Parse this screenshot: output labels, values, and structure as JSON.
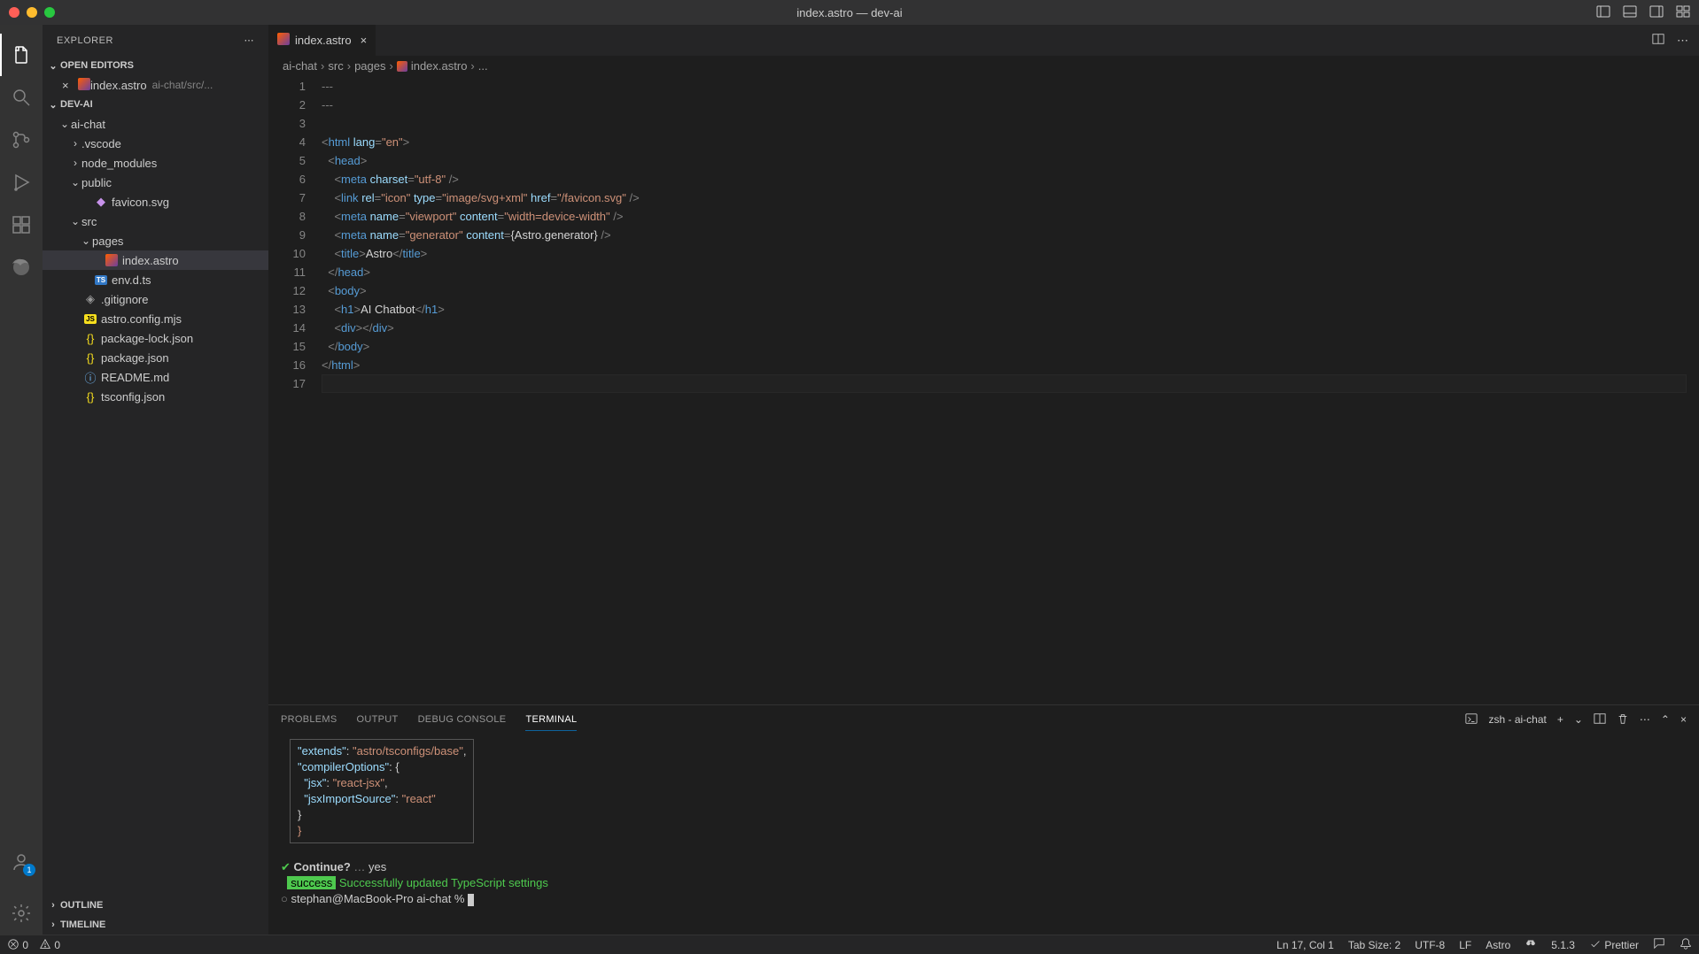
{
  "titlebar": {
    "title": "index.astro — dev-ai"
  },
  "sidebar": {
    "title": "EXPLORER",
    "sections": {
      "open_editors": {
        "label": "OPEN EDITORS",
        "items": [
          {
            "name": "index.astro",
            "path": "ai-chat/src/..."
          }
        ]
      },
      "workspace": {
        "label": "DEV-AI",
        "tree": [
          {
            "name": "ai-chat",
            "depth": 1,
            "expanded": true,
            "folder": true
          },
          {
            "name": ".vscode",
            "depth": 2,
            "expanded": false,
            "folder": true
          },
          {
            "name": "node_modules",
            "depth": 2,
            "expanded": false,
            "folder": true
          },
          {
            "name": "public",
            "depth": 2,
            "expanded": true,
            "folder": true
          },
          {
            "name": "favicon.svg",
            "depth": 3,
            "folder": false,
            "icon": "svg"
          },
          {
            "name": "src",
            "depth": 2,
            "expanded": true,
            "folder": true
          },
          {
            "name": "pages",
            "depth": 3,
            "expanded": true,
            "folder": true
          },
          {
            "name": "index.astro",
            "depth": 4,
            "folder": false,
            "icon": "astro",
            "selected": true
          },
          {
            "name": "env.d.ts",
            "depth": 3,
            "folder": false,
            "icon": "ts"
          },
          {
            "name": ".gitignore",
            "depth": 2,
            "folder": false,
            "icon": "git"
          },
          {
            "name": "astro.config.mjs",
            "depth": 2,
            "folder": false,
            "icon": "js"
          },
          {
            "name": "package-lock.json",
            "depth": 2,
            "folder": false,
            "icon": "json"
          },
          {
            "name": "package.json",
            "depth": 2,
            "folder": false,
            "icon": "json"
          },
          {
            "name": "README.md",
            "depth": 2,
            "folder": false,
            "icon": "info"
          },
          {
            "name": "tsconfig.json",
            "depth": 2,
            "folder": false,
            "icon": "json"
          }
        ]
      },
      "outline": {
        "label": "OUTLINE"
      },
      "timeline": {
        "label": "TIMELINE"
      }
    }
  },
  "tabs": [
    {
      "label": "index.astro"
    }
  ],
  "breadcrumb": [
    "ai-chat",
    "src",
    "pages",
    "index.astro",
    "..."
  ],
  "code": {
    "lines": [
      {
        "n": 1,
        "html": "<span class='tok-gray'>---</span>"
      },
      {
        "n": 2,
        "html": "<span class='tok-gray'>---</span>"
      },
      {
        "n": 3,
        "html": ""
      },
      {
        "n": 4,
        "html": "<span class='tok-gray'>&lt;</span><span class='tok-tag'>html</span> <span class='tok-attr'>lang</span><span class='tok-gray'>=</span><span class='tok-str'>\"en\"</span><span class='tok-gray'>&gt;</span>"
      },
      {
        "n": 5,
        "html": "  <span class='tok-gray'>&lt;</span><span class='tok-tag'>head</span><span class='tok-gray'>&gt;</span>"
      },
      {
        "n": 6,
        "html": "    <span class='tok-gray'>&lt;</span><span class='tok-tag'>meta</span> <span class='tok-attr'>charset</span><span class='tok-gray'>=</span><span class='tok-str'>\"utf-8\"</span> <span class='tok-gray'>/&gt;</span>"
      },
      {
        "n": 7,
        "html": "    <span class='tok-gray'>&lt;</span><span class='tok-tag'>link</span> <span class='tok-attr'>rel</span><span class='tok-gray'>=</span><span class='tok-str'>\"icon\"</span> <span class='tok-attr'>type</span><span class='tok-gray'>=</span><span class='tok-str'>\"image/svg+xml\"</span> <span class='tok-attr'>href</span><span class='tok-gray'>=</span><span class='tok-str'>\"/favicon.svg\"</span> <span class='tok-gray'>/&gt;</span>"
      },
      {
        "n": 8,
        "html": "    <span class='tok-gray'>&lt;</span><span class='tok-tag'>meta</span> <span class='tok-attr'>name</span><span class='tok-gray'>=</span><span class='tok-str'>\"viewport\"</span> <span class='tok-attr'>content</span><span class='tok-gray'>=</span><span class='tok-str'>\"width=device-width\"</span> <span class='tok-gray'>/&gt;</span>"
      },
      {
        "n": 9,
        "html": "    <span class='tok-gray'>&lt;</span><span class='tok-tag'>meta</span> <span class='tok-attr'>name</span><span class='tok-gray'>=</span><span class='tok-str'>\"generator\"</span> <span class='tok-attr'>content</span><span class='tok-gray'>=</span><span class='tok-text'>{Astro.generator}</span> <span class='tok-gray'>/&gt;</span>"
      },
      {
        "n": 10,
        "html": "    <span class='tok-gray'>&lt;</span><span class='tok-tag'>title</span><span class='tok-gray'>&gt;</span><span class='tok-text'>Astro</span><span class='tok-gray'>&lt;/</span><span class='tok-tag'>title</span><span class='tok-gray'>&gt;</span>"
      },
      {
        "n": 11,
        "html": "  <span class='tok-gray'>&lt;/</span><span class='tok-tag'>head</span><span class='tok-gray'>&gt;</span>"
      },
      {
        "n": 12,
        "html": "  <span class='tok-gray'>&lt;</span><span class='tok-tag'>body</span><span class='tok-gray'>&gt;</span>"
      },
      {
        "n": 13,
        "html": "    <span class='tok-gray'>&lt;</span><span class='tok-tag'>h1</span><span class='tok-gray'>&gt;</span><span class='tok-text'>AI Chatbot</span><span class='tok-gray'>&lt;/</span><span class='tok-tag'>h1</span><span class='tok-gray'>&gt;</span>"
      },
      {
        "n": 14,
        "html": "    <span class='tok-gray'>&lt;</span><span class='tok-tag'>div</span><span class='tok-gray'>&gt;&lt;/</span><span class='tok-tag'>div</span><span class='tok-gray'>&gt;</span>"
      },
      {
        "n": 15,
        "html": "  <span class='tok-gray'>&lt;/</span><span class='tok-tag'>body</span><span class='tok-gray'>&gt;</span>"
      },
      {
        "n": 16,
        "html": "<span class='tok-gray'>&lt;/</span><span class='tok-tag'>html</span><span class='tok-gray'>&gt;</span>"
      },
      {
        "n": 17,
        "html": ""
      }
    ]
  },
  "panel": {
    "tabs": [
      "PROBLEMS",
      "OUTPUT",
      "DEBUG CONSOLE",
      "TERMINAL"
    ],
    "active_tab": "TERMINAL",
    "terminal_label": "zsh - ai-chat",
    "terminal": {
      "box_lines": [
        "  \"extends\": \"astro/tsconfigs/base\",",
        "  \"compilerOptions\": {",
        "    \"jsx\": \"react-jsx\",",
        "    \"jsxImportSource\": \"react\"",
        "  }",
        "}"
      ],
      "continue_prompt": "Continue?",
      "continue_dots": "…",
      "continue_answer": "yes",
      "success_pill": "success",
      "success_msg": "Successfully updated TypeScript settings",
      "prompt": "stephan@MacBook-Pro ai-chat %"
    }
  },
  "statusbar": {
    "errors": "0",
    "warnings": "0",
    "cursor": "Ln 17, Col 1",
    "tab_size": "Tab Size: 2",
    "encoding": "UTF-8",
    "eol": "LF",
    "lang": "Astro",
    "version": "5.1.3",
    "prettier": "Prettier"
  },
  "activity_badge": "1"
}
